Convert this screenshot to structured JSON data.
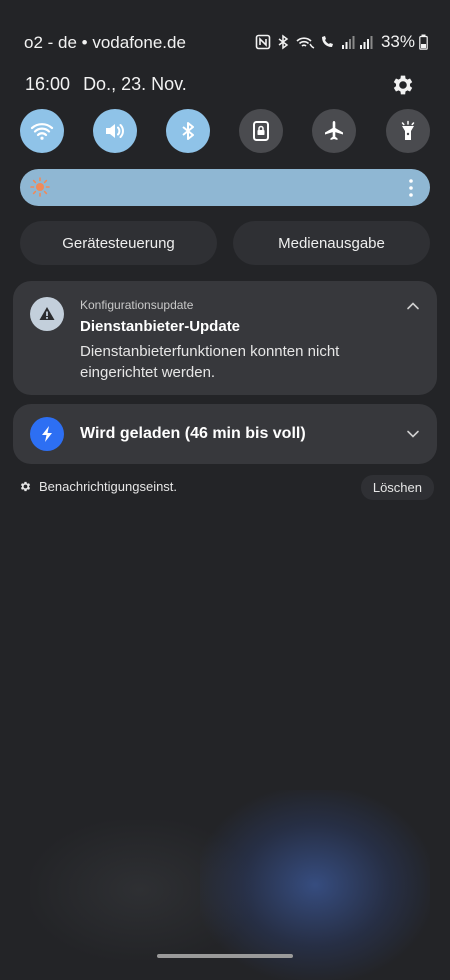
{
  "status_bar": {
    "carrier": "o2 - de • vodafone.de",
    "battery": "33%",
    "icons": [
      "nfc-icon",
      "bluetooth-icon",
      "wifi-call-icon",
      "volte-call-icon",
      "signal-icon",
      "signal-icon",
      "battery-icon"
    ]
  },
  "header": {
    "time": "16:00",
    "date": "Do., 23. Nov."
  },
  "quick_toggles": [
    {
      "name": "wifi",
      "state": "on"
    },
    {
      "name": "sound",
      "state": "on"
    },
    {
      "name": "bluetooth",
      "state": "on"
    },
    {
      "name": "portrait-lock",
      "state": "off"
    },
    {
      "name": "airplane-mode",
      "state": "off"
    },
    {
      "name": "flashlight",
      "state": "off"
    }
  ],
  "brightness": {
    "level": 1.0
  },
  "buttons": {
    "device_control": "Gerätesteuerung",
    "media_output": "Medienausgabe"
  },
  "notifications": [
    {
      "app": "Konfigurationsupdate",
      "title": "Dienstanbieter-Update",
      "text": "Dienstanbieterfunktionen konnten nicht eingerichtet werden.",
      "expanded": true
    },
    {
      "title": "Wird geladen (46 min bis voll)",
      "expanded": false
    }
  ],
  "footer": {
    "settings_label": "Benachrichtigungseinst.",
    "clear_label": "Löschen"
  },
  "colors": {
    "background": "#232427",
    "toggle_on": "#8fc3e8",
    "toggle_off": "#4a4b4f",
    "card": "#37383c",
    "charge_icon": "#2d6ff3"
  }
}
